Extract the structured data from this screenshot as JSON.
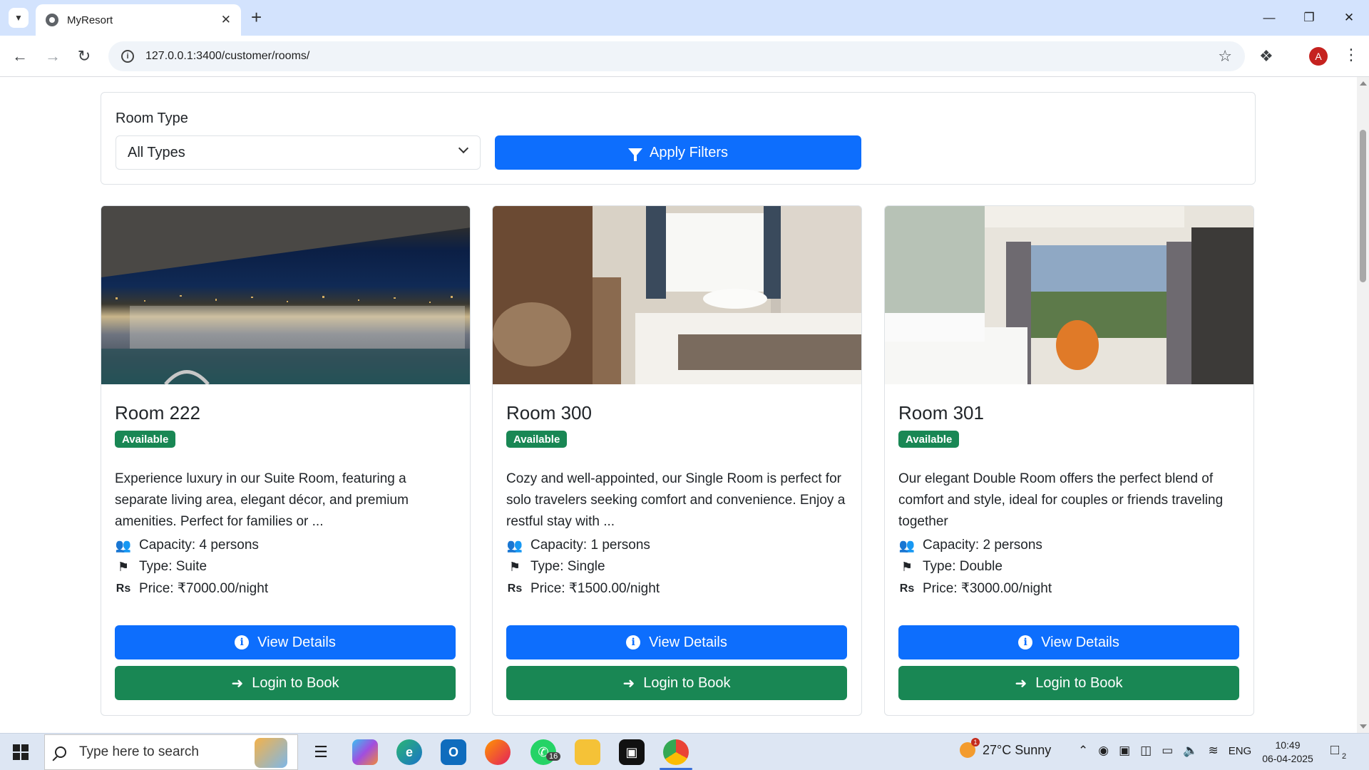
{
  "browser": {
    "tab_title": "MyResort",
    "url": "127.0.0.1:3400/customer/rooms/",
    "profile_initial": "A"
  },
  "filters": {
    "room_type_label": "Room Type",
    "room_type_value": "All Types",
    "apply_label": "Apply Filters"
  },
  "rooms": [
    {
      "title": "Room 222",
      "status": "Available",
      "description": "Experience luxury in our Suite Room, featuring a separate living area, elegant décor, and premium amenities. Perfect for families or ...",
      "capacity": "Capacity: 4 persons",
      "type": "Type: Suite",
      "price": "Price: ₹7000.00/night",
      "view_label": "View Details",
      "book_label": "Login to Book"
    },
    {
      "title": "Room 300",
      "status": "Available",
      "description": "Cozy and well-appointed, our Single Room is perfect for solo travelers seeking comfort and convenience. Enjoy a restful stay with ...",
      "capacity": "Capacity: 1 persons",
      "type": "Type: Single",
      "price": "Price: ₹1500.00/night",
      "view_label": "View Details",
      "book_label": "Login to Book"
    },
    {
      "title": "Room 301",
      "status": "Available",
      "description": "Our elegant Double Room offers the perfect blend of comfort and style, ideal for couples or friends traveling together",
      "capacity": "Capacity: 2 persons",
      "type": "Type: Double",
      "price": "Price: ₹3000.00/night",
      "view_label": "View Details",
      "book_label": "Login to Book"
    }
  ],
  "taskbar": {
    "search_placeholder": "Type here to search",
    "whatsapp_badge": "16",
    "weather": "27°C  Sunny",
    "weather_alert": "1",
    "language": "ENG",
    "time": "10:49",
    "date": "06-04-2025",
    "notification_count": "2"
  },
  "colors": {
    "primary": "#0d6efd",
    "success": "#198754",
    "tabbar": "#d3e3fd"
  }
}
